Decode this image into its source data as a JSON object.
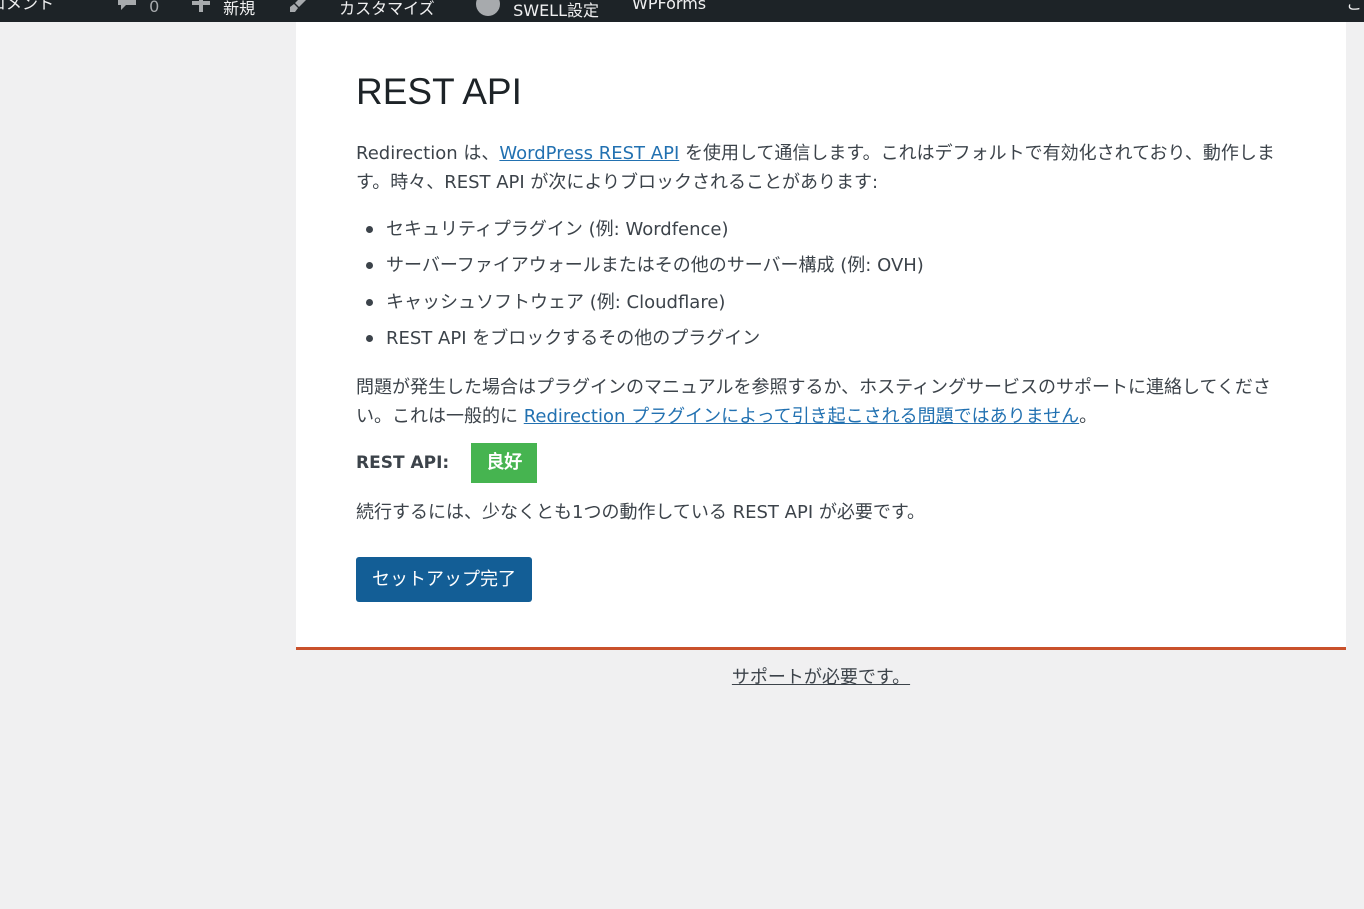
{
  "admin_bar": {
    "items": [
      {
        "icon": "",
        "label": "コメント"
      },
      {
        "icon": "comment-icon",
        "label": "0"
      },
      {
        "icon": "plus-icon",
        "label": "新規"
      },
      {
        "icon": "brush-icon",
        "label": "カスタマイズ"
      },
      {
        "icon": "swell-icon",
        "label": "SWELL設定"
      },
      {
        "icon": "",
        "label": "WPForms"
      },
      {
        "icon": "",
        "label": "こ"
      }
    ]
  },
  "main": {
    "title": "REST API",
    "intro": {
      "before": "Redirection は、",
      "link": "WordPress REST API",
      "after": " を使用して通信します。これはデフォルトで有効化されており、動作します。時々、REST API が次によりブロックされることがあります:"
    },
    "blockers": [
      "セキュリティプラグイン (例: Wordfence)",
      "サーバーファイアウォールまたはその他のサーバー構成 (例: OVH)",
      "キャッシュソフトウェア (例: Cloudflare)",
      "REST API をブロックするその他のプラグイン"
    ],
    "problem": {
      "before": "問題が発生した場合はプラグインのマニュアルを参照するか、ホスティングサービスのサポートに連絡してください。これは一般的に ",
      "link": "Redirection プラグインによって引き起こされる問題ではありません",
      "after": "。"
    },
    "status": {
      "label": "REST API:",
      "value": "良好",
      "color": "#46b450"
    },
    "requirement": "続行するには、少なくとも1つの動作している REST API が必要です。",
    "finish_button": "セットアップ完了"
  },
  "footer": {
    "help_link": "サポートが必要です。"
  },
  "colors": {
    "admin_bar": "#1d2327",
    "accent_border": "#c9512b",
    "button": "#135e96",
    "link": "#2271b1"
  }
}
